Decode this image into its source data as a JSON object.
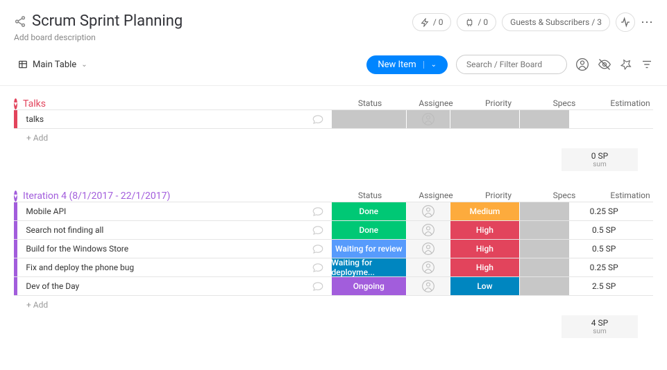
{
  "header": {
    "title": "Scrum Sprint Planning",
    "description": "Add board description",
    "bolt_count": "/ 0",
    "robot_count": "/ 0",
    "guests_label": "Guests & Subscribers / 3"
  },
  "toolbar": {
    "main_table": "Main Table",
    "new_item": "New Item",
    "search_placeholder": "Search / Filter Board"
  },
  "columns": [
    "Status",
    "Assignee",
    "Priority",
    "Specs",
    "Estimation"
  ],
  "groups": [
    {
      "name": "Talks",
      "color": "#e2445c",
      "bar": "bar-pink",
      "bar_light": "bar-pinklight",
      "rows": [
        {
          "name": "talks",
          "status": "",
          "status_bg": "#c7c7c7",
          "assignee_bg": "#c7c7c7",
          "priority": "",
          "priority_bg": "#c7c7c7",
          "specs_bg": "#c7c7c7",
          "est": ""
        }
      ],
      "add": "+ Add",
      "sum_value": "0 SP",
      "sum_label": "sum"
    },
    {
      "name": "Iteration 4 (8/1/2017 - 22/1/2017)",
      "color": "#a25ddc",
      "bar": "bar-purple",
      "bar_light": "bar-purplelight",
      "rows": [
        {
          "name": "Mobile API",
          "status": "Done",
          "status_bg": "#00c875",
          "assignee_bg": "#f6f6f6",
          "priority": "Medium",
          "priority_bg": "#fdab3d",
          "specs_bg": "#c7c7c7",
          "est": "0.25 SP"
        },
        {
          "name": "Search not finding all",
          "status": "Done",
          "status_bg": "#00c875",
          "assignee_bg": "#f6f6f6",
          "priority": "High",
          "priority_bg": "#e2445c",
          "specs_bg": "#c7c7c7",
          "est": "0.5 SP"
        },
        {
          "name": "Build for the Windows Store",
          "status": "Waiting for review",
          "status_bg": "#579bfc",
          "assignee_bg": "#f6f6f6",
          "priority": "High",
          "priority_bg": "#e2445c",
          "specs_bg": "#c7c7c7",
          "est": "0.5 SP"
        },
        {
          "name": "Fix and deploy the phone bug",
          "status": "Waiting for deployme...",
          "status_bg": "#0086c0",
          "assignee_bg": "#f6f6f6",
          "priority": "High",
          "priority_bg": "#e2445c",
          "specs_bg": "#c7c7c7",
          "est": "0.25 SP"
        },
        {
          "name": "Dev of the Day",
          "status": "Ongoing",
          "status_bg": "#a25ddc",
          "assignee_bg": "#f6f6f6",
          "priority": "Low",
          "priority_bg": "#0086c0",
          "specs_bg": "#c7c7c7",
          "est": "2.5 SP"
        }
      ],
      "add": "+ Add",
      "sum_value": "4 SP",
      "sum_label": "sum"
    }
  ]
}
